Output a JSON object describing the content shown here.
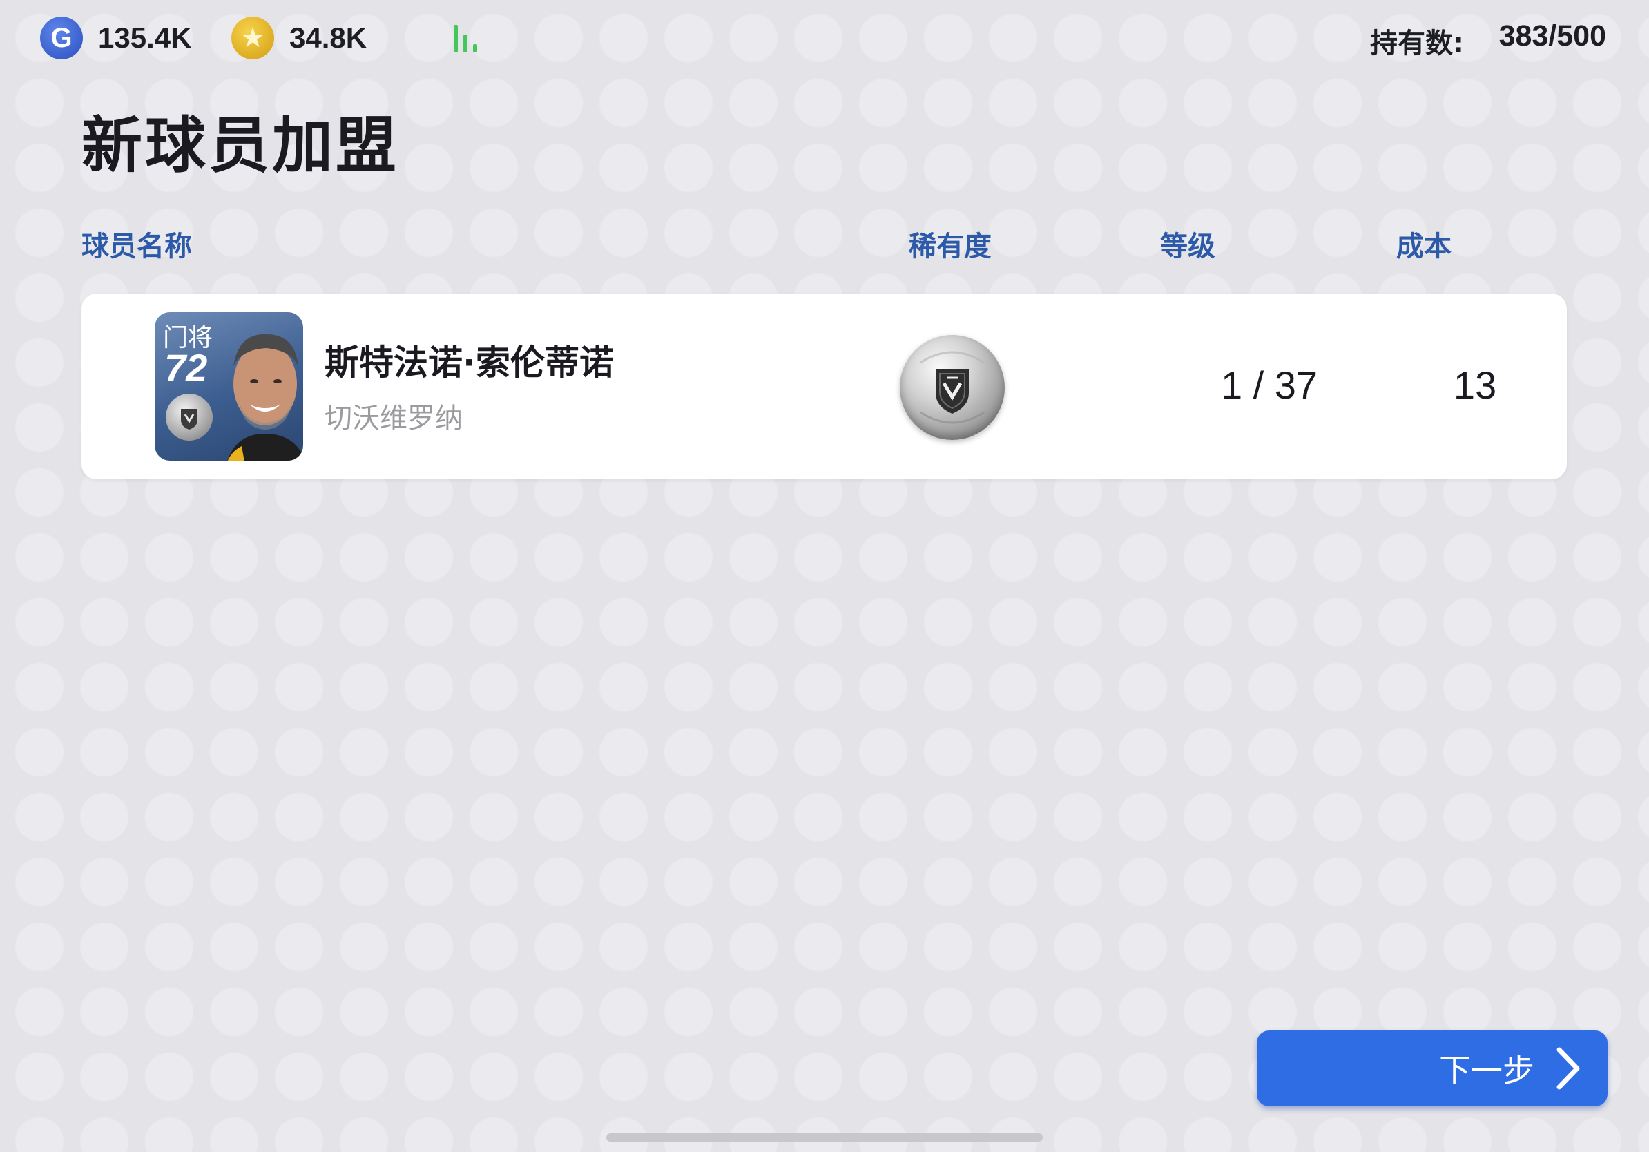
{
  "topbar": {
    "gp": {
      "icon": "gp-coin-icon",
      "letter": "G",
      "value": "135.4K"
    },
    "coins": {
      "icon": "star-coin-icon",
      "glyph": "★",
      "value": "34.8K"
    },
    "signal_icon": "signal-bars-icon",
    "holdings": {
      "label": "持有数:",
      "value": "383/500"
    }
  },
  "page": {
    "title": "新球员加盟"
  },
  "columns": {
    "name": "球员名称",
    "rarity": "稀有度",
    "level": "等级",
    "cost": "成本"
  },
  "players": [
    {
      "position": "门将",
      "rating": "72",
      "name": "斯特法诺·索伦蒂诺",
      "club": "切沃维罗纳",
      "rarity_icon": "silver-ball-icon",
      "level": "1 / 37",
      "cost": "13"
    }
  ],
  "actions": {
    "next_label": "下一步",
    "next_icon": "chevron-right-icon"
  },
  "colors": {
    "accent": "#2f6de5",
    "header_text": "#2c5aa8",
    "signal": "#41c75c"
  }
}
